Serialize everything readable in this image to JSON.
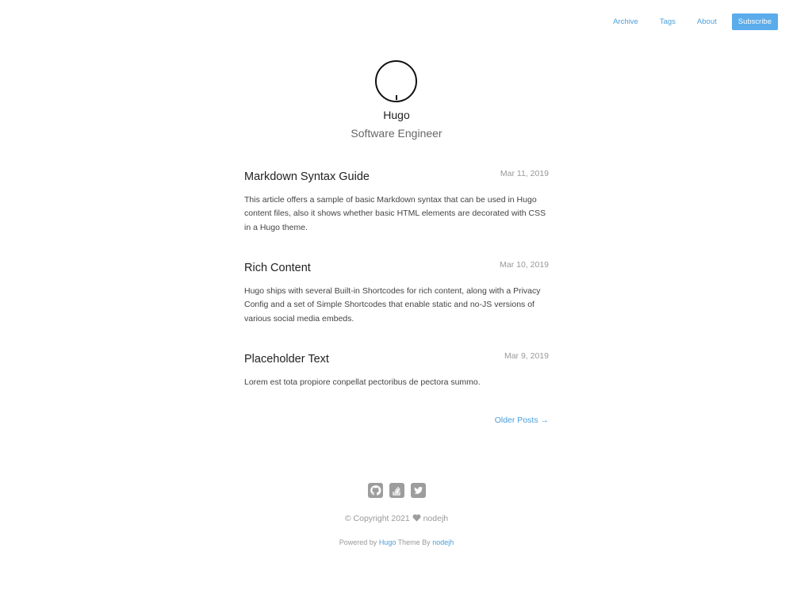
{
  "nav": {
    "archive": "Archive",
    "tags": "Tags",
    "about": "About",
    "subscribe": "Subscribe"
  },
  "site": {
    "title": "Hugo",
    "subtitle": "Software Engineer"
  },
  "posts": [
    {
      "title": "Markdown Syntax Guide",
      "date": "Mar 11, 2019",
      "summary": "This article offers a sample of basic Markdown syntax that can be used in Hugo content files, also it shows whether basic HTML elements are decorated with CSS in a Hugo theme."
    },
    {
      "title": "Rich Content",
      "date": "Mar 10, 2019",
      "summary": "Hugo ships with several Built-in Shortcodes for rich content, along with a Privacy Config and a set of Simple Shortcodes that enable static and no-JS versions of various social media embeds."
    },
    {
      "title": "Placeholder Text",
      "date": "Mar 9, 2019",
      "summary": "Lorem est tota propiore conpellat pectoribus de pectora summo."
    }
  ],
  "pagination": {
    "older": "Older Posts →"
  },
  "social": {
    "icons": [
      "github-icon",
      "stackoverflow-icon",
      "twitter-icon"
    ],
    "color": "#9d9d9d"
  },
  "footer": {
    "copyright_prefix": "© Copyright 2021",
    "copyright_author": "nodejh",
    "powered_prefix": "Powered by",
    "powered_hugo": "Hugo",
    "powered_middle": "Theme By",
    "powered_author": "nodejh"
  },
  "colors": {
    "accent": "#4a9fd8",
    "subscribe_bg": "#5aaceb",
    "muted": "#999999"
  }
}
